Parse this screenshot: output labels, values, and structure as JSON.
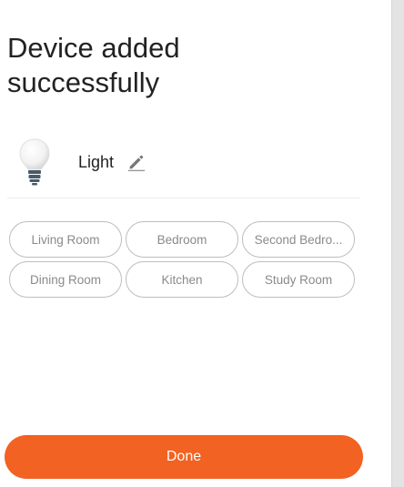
{
  "page": {
    "title": "Device added successfully"
  },
  "device": {
    "name": "Light",
    "icon": "light-bulb-icon",
    "edit_icon": "pencil-icon"
  },
  "rooms": [
    {
      "label": "Living Room"
    },
    {
      "label": "Bedroom"
    },
    {
      "label": "Second Bedro..."
    },
    {
      "label": "Dining Room"
    },
    {
      "label": "Kitchen"
    },
    {
      "label": "Study Room"
    }
  ],
  "actions": {
    "done_label": "Done"
  },
  "colors": {
    "accent": "#f26222",
    "chip_border": "#bdbdbd",
    "chip_text": "#8a8a8a",
    "title_text": "#222222"
  }
}
